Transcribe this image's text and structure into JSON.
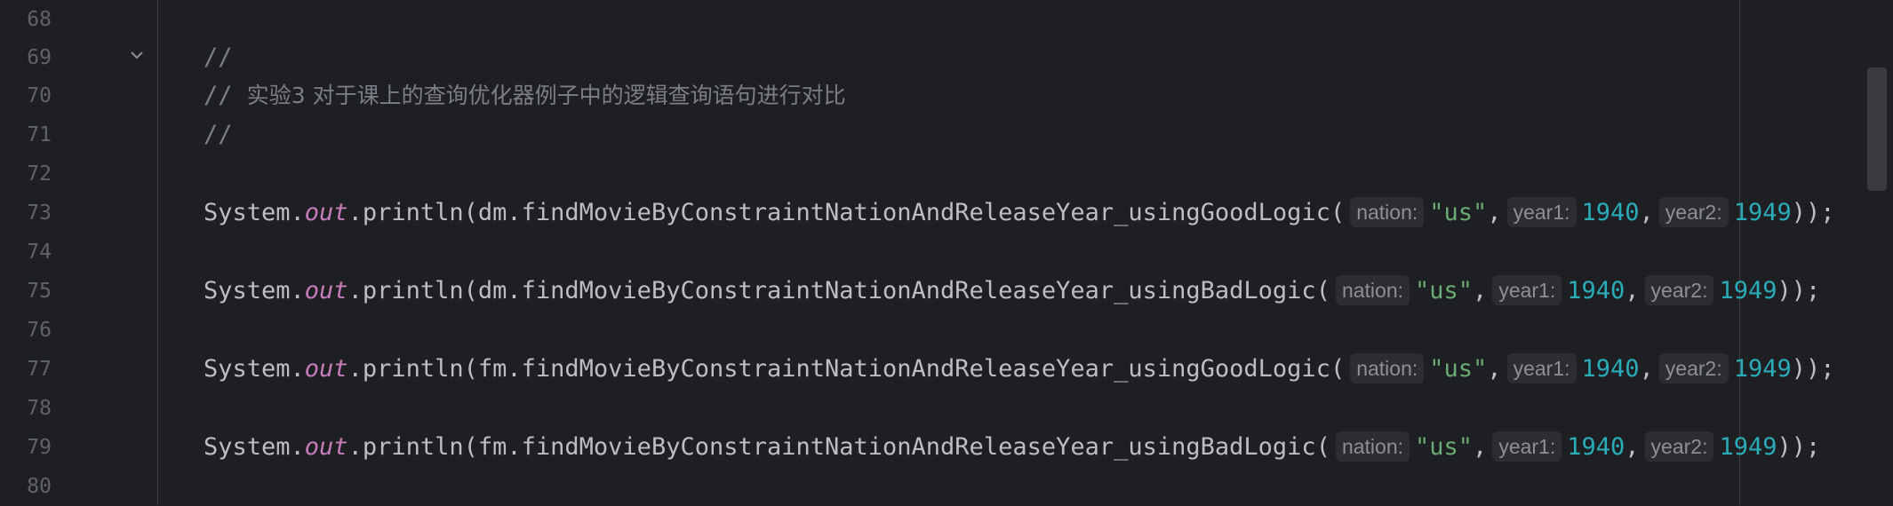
{
  "editor": {
    "lines": [
      {
        "number": "68"
      },
      {
        "number": "69",
        "comment": "//"
      },
      {
        "number": "70",
        "comment_prefix": "// ",
        "comment_text": "实验3 对于课上的查询优化器例子中的逻辑查询语句进行对比"
      },
      {
        "number": "71",
        "comment": "//"
      },
      {
        "number": "72"
      },
      {
        "number": "73",
        "prefix": "System.",
        "field": "out",
        "call": ".println(dm.findMovieByConstraintNationAndReleaseYear_usingGoodLogic(",
        "hint1": "nation:",
        "arg1": "\"us\"",
        "sep1": ",",
        "hint2": "year1:",
        "arg2": "1940",
        "sep2": ",",
        "hint3": "year2:",
        "arg3": "1949",
        "suffix": "));"
      },
      {
        "number": "74"
      },
      {
        "number": "75",
        "prefix": "System.",
        "field": "out",
        "call": ".println(dm.findMovieByConstraintNationAndReleaseYear_usingBadLogic(",
        "hint1": "nation:",
        "arg1": "\"us\"",
        "sep1": ",",
        "hint2": "year1:",
        "arg2": "1940",
        "sep2": ",",
        "hint3": "year2:",
        "arg3": "1949",
        "suffix": "));"
      },
      {
        "number": "76"
      },
      {
        "number": "77",
        "prefix": "System.",
        "field": "out",
        "call": ".println(fm.findMovieByConstraintNationAndReleaseYear_usingGoodLogic(",
        "hint1": "nation:",
        "arg1": "\"us\"",
        "sep1": ",",
        "hint2": "year1:",
        "arg2": "1940",
        "sep2": ",",
        "hint3": "year2:",
        "arg3": "1949",
        "suffix": "));"
      },
      {
        "number": "78"
      },
      {
        "number": "79",
        "prefix": "System.",
        "field": "out",
        "call": ".println(fm.findMovieByConstraintNationAndReleaseYear_usingBadLogic(",
        "hint1": "nation:",
        "arg1": "\"us\"",
        "sep1": ",",
        "hint2": "year1:",
        "arg2": "1940",
        "sep2": ",",
        "hint3": "year2:",
        "arg3": "1949",
        "suffix": "));"
      },
      {
        "number": "80"
      }
    ],
    "fold_icon": "chevron-down-icon"
  },
  "colors": {
    "background": "#1e1f22",
    "comment": "#7a7e85",
    "string": "#6aab73",
    "number": "#2aacb8",
    "static_field": "#c77dbb",
    "line_number": "#5f6368"
  }
}
